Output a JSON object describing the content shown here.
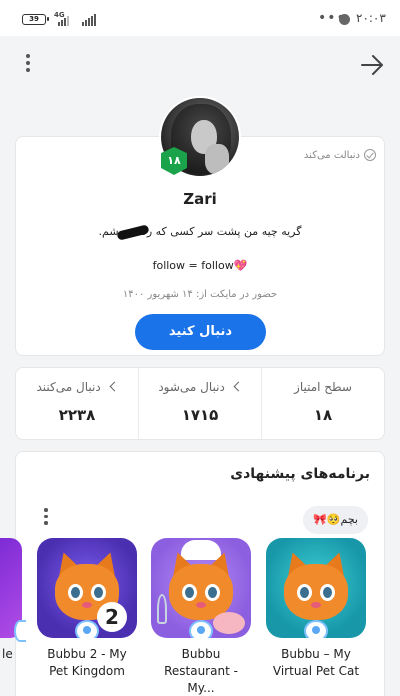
{
  "status_bar": {
    "battery": "39",
    "network": "4G",
    "time": "۲۰:۰۳"
  },
  "profile": {
    "follows_you": "دنبالت می‌کند",
    "level": "۱۸",
    "username": "Zari",
    "bio_line1": "گریه چیه من پشت سر کسی که رفته م    شم.",
    "bio_line2": "follow = follow",
    "bio_emoji": "💖",
    "joined": "حضور در مایکت از: ۱۴ شهریور ۱۴۰۰",
    "follow_button": "دنبال کنید"
  },
  "stats": {
    "followers_label": "دنبال می‌کنند",
    "followers_value": "۲۲۳۸",
    "following_label": "دنبال می‌شود",
    "following_value": "۱۷۱۵",
    "level_label": "سطح امتیاز",
    "level_value": "۱۸"
  },
  "suggested": {
    "title": "برنامه‌های پیشنهادی",
    "chip_label": "بچم",
    "chip_emoji": "🥺🎀",
    "apps": [
      {
        "name": "Bubbu – My Virtual Pet Cat",
        "icon": "orange-cat-icon",
        "bg": "#22b8c6"
      },
      {
        "name": "Bubbu Restaurant - My...",
        "icon": "chef-cat-icon",
        "bg": "#9b6ee8"
      },
      {
        "name": "Bubbu 2 - My Pet Kingdom",
        "icon": "cat-2-icon",
        "bg": "#5f3fd0"
      }
    ],
    "partial_app_name": "le"
  }
}
